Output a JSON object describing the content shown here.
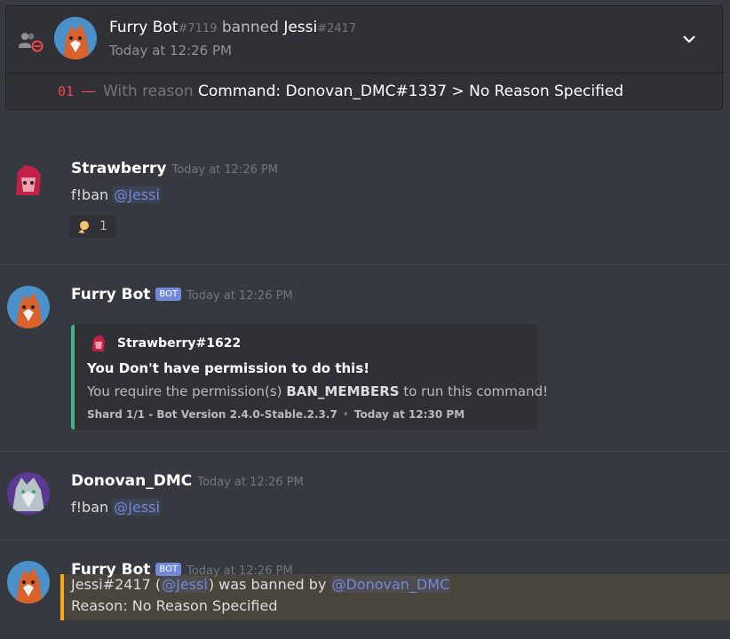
{
  "audit": {
    "actor": "Furry Bot",
    "actor_discrim": "#7119",
    "action": "banned",
    "target": "Jessi",
    "target_discrim": "#2417",
    "time": "Today at 12:26 PM",
    "change_number": "01",
    "dash": "—",
    "reason_prefix": "With reason",
    "reason_text": "Command: Donovan_DMC#1337 > No Reason Specified"
  },
  "messages": [
    {
      "author": "Strawberry",
      "time": "Today at 12:26 PM",
      "content_prefix": "f!ban",
      "mention": "@Jessi",
      "reaction_count": "1"
    },
    {
      "author": "Furry Bot",
      "bot_tag": "BOT",
      "time": "Today at 12:26 PM",
      "embed": {
        "author": "Strawberry#1622",
        "title": "You Don't have permission to do this!",
        "desc_prefix": "You require the permission(s)",
        "desc_bold": "BAN_MEMBERS",
        "desc_suffix": "to run this command!",
        "footer": "Shard 1/1 - Bot Version 2.4.0-Stable.2.3.7",
        "footer_bullet": "•",
        "timestamp": "Today at 12:30 PM",
        "color": "#43b581"
      }
    },
    {
      "author": "Donovan_DMC",
      "time": "Today at 12:26 PM",
      "content_prefix": "f!ban",
      "mention": "@Jessi"
    },
    {
      "author": "Furry Bot",
      "bot_tag": "BOT",
      "time": "Today at 12:26 PM",
      "line1_prefix": "Jessi#2417 (",
      "line1_mention": "@Jessi",
      "line1_mid": ") was banned by",
      "line1_mention2": "@Donovan_DMC",
      "line2": "Reason: No Reason Specified"
    }
  ],
  "colors": {
    "background": "#36393f",
    "mention": "#7289da",
    "highlight_border": "#faa61a",
    "embed_border": "#43b581",
    "audit_number": "#f04747"
  }
}
